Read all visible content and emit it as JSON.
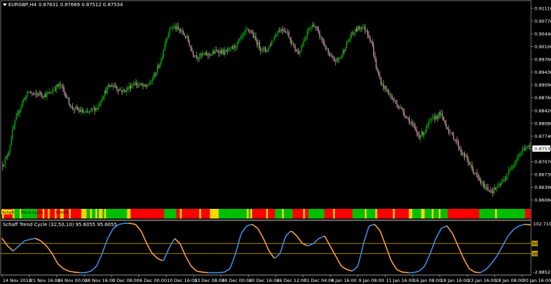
{
  "header": {
    "symbol": "EURGBP,H4",
    "ohlc": "0.87631 0.87669 0.87512 0.87534"
  },
  "histogram": {
    "label_start": "Schaff",
    "label_mid": "Trend Cycle",
    "value_label": "3.0000"
  },
  "indicator": {
    "title": "Schaff Trend Cycle (32,50,10) 95.6055 95.6055"
  },
  "colors": {
    "bull": "#00c800",
    "bear": "#e3a6b8",
    "frame": "#c0c0c0",
    "stc_up": "#3c8ce6",
    "stc_down": "#ff9e3c",
    "level": "#c8a000",
    "hist_green": "#00c000",
    "hist_red": "#ff0000",
    "hist_yellow": "#ffd700"
  },
  "chart_data": [
    {
      "type": "candlestick",
      "title": "EURGBP,H4",
      "ylim": [
        0.8606,
        0.9111
      ],
      "y_ticks": [
        "0.91110",
        "0.90770",
        "0.90440",
        "0.90100",
        "0.89760",
        "0.89430",
        "0.89090",
        "0.88760",
        "0.88420",
        "0.88080",
        "0.87740",
        "0.87400",
        "0.87070",
        "0.86730",
        "0.86390",
        "0.86060"
      ],
      "current_price": "0.87534",
      "x_ticks": [
        "14 Nov 2018",
        "21 Nov 16:00",
        "26 Nov 00:00",
        "28 Nov 16:00",
        "3 Dec 08:00",
        "6 Dec 00:00",
        "10 Dec 16:00",
        "13 Dec 08:00",
        "18 Dec 00:00",
        "20 Dec 16:00",
        "26 Dec 12:00",
        "31 Dec 04:00",
        "4 Jan 16:00",
        "9 Jan 08:00",
        "11 Jan 16:00",
        "16 Jan 08:00",
        "18 Jan 16:00",
        "23 Jan 16:00",
        "28 Jan 08:00",
        "30 Jan 16:00"
      ],
      "close_path": [
        0.871,
        0.8735,
        0.88,
        0.884,
        0.887,
        0.889,
        0.888,
        0.8885,
        0.888,
        0.8885,
        0.89,
        0.8905,
        0.888,
        0.885,
        0.8845,
        0.884,
        0.8835,
        0.8845,
        0.885,
        0.888,
        0.89,
        0.8905,
        0.8895,
        0.889,
        0.89,
        0.891,
        0.8905,
        0.89,
        0.891,
        0.8935,
        0.8965,
        0.902,
        0.905,
        0.9045,
        0.9035,
        0.902,
        0.8985,
        0.8975,
        0.898,
        0.898,
        0.8985,
        0.899,
        0.8985,
        0.899,
        0.9,
        0.9015,
        0.9035,
        0.904,
        0.9015,
        0.8995,
        0.899,
        0.901,
        0.9035,
        0.9045,
        0.9035,
        0.9005,
        0.8985,
        0.9005,
        0.904,
        0.9055,
        0.903,
        0.9005,
        0.8975,
        0.8965,
        0.897,
        0.9,
        0.9025,
        0.904,
        0.905,
        0.904,
        0.901,
        0.894,
        0.8905,
        0.889,
        0.887,
        0.8855,
        0.884,
        0.882,
        0.88,
        0.878,
        0.879,
        0.8815,
        0.8825,
        0.8835,
        0.881,
        0.8785,
        0.877,
        0.874,
        0.8725,
        0.87,
        0.868,
        0.866,
        0.865,
        0.8645,
        0.8655,
        0.867,
        0.869,
        0.8715,
        0.8735,
        0.875,
        0.8753
      ]
    },
    {
      "type": "line",
      "title": "Schaff Trend Cycle (32,50,10) 95.6055 95.6055",
      "ylim": [
        0,
        102.71
      ],
      "y_ticks": [
        "102.7103",
        "-2.8852"
      ],
      "levels": [
        "60",
        "40"
      ],
      "stc_path": [
        70,
        55,
        45,
        55,
        65,
        68,
        70,
        65,
        55,
        40,
        20,
        10,
        5,
        3,
        2,
        2,
        5,
        15,
        40,
        70,
        90,
        98,
        100,
        100,
        98,
        85,
        60,
        40,
        30,
        25,
        50,
        70,
        60,
        35,
        15,
        5,
        3,
        2,
        2,
        2,
        3,
        10,
        40,
        80,
        95,
        98,
        90,
        70,
        45,
        30,
        40,
        75,
        85,
        75,
        60,
        55,
        60,
        70,
        75,
        55,
        35,
        15,
        8,
        5,
        15,
        60,
        95,
        98,
        85,
        55,
        25,
        8,
        3,
        2,
        2,
        5,
        15,
        40,
        70,
        90,
        95,
        80,
        55,
        30,
        10,
        3,
        2,
        8,
        20,
        35,
        55,
        75,
        88,
        95,
        98,
        97
      ]
    }
  ]
}
